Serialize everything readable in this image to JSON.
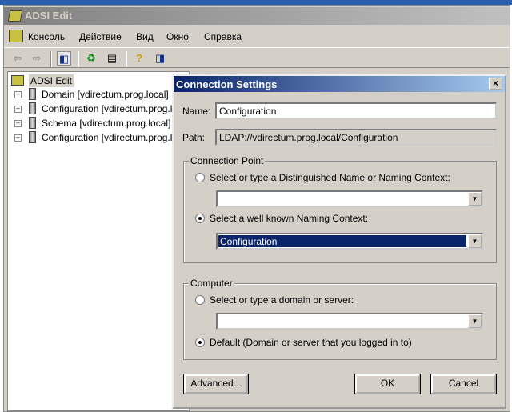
{
  "app": {
    "title": "ADSI Edit"
  },
  "menu": [
    "Консоль",
    "Действие",
    "Вид",
    "Окно",
    "Справка"
  ],
  "toolbar": [
    "back-icon",
    "forward-icon",
    "show-hide-tree-icon",
    "refresh-icon",
    "export-list-icon",
    "help-icon",
    "show-hide-action-pane-icon"
  ],
  "tree": {
    "root": "ADSI Edit",
    "items": [
      "Domain [vdirectum.prog.local]",
      "Configuration [vdirectum.prog.local]",
      "Schema [vdirectum.prog.local]",
      "Configuration [vdirectum.prog.local]"
    ]
  },
  "dialog": {
    "title": "Connection Settings",
    "close": "×",
    "name_label": "Name:",
    "name_value": "Configuration",
    "path_label": "Path:",
    "path_value": "LDAP://vdirectum.prog.local/Configuration",
    "cp_group": "Connection Point",
    "cp_radio1": "Select or type a Distinguished Name or Naming Context:",
    "cp_combo1": "",
    "cp_radio2": "Select a well known Naming Context:",
    "cp_combo2": "Configuration",
    "comp_group": "Computer",
    "comp_radio1": "Select or type a domain or server:",
    "comp_combo": "",
    "comp_radio2": "Default (Domain or server that you logged in to)",
    "advanced": "Advanced...",
    "ok": "OK",
    "cancel": "Cancel"
  }
}
